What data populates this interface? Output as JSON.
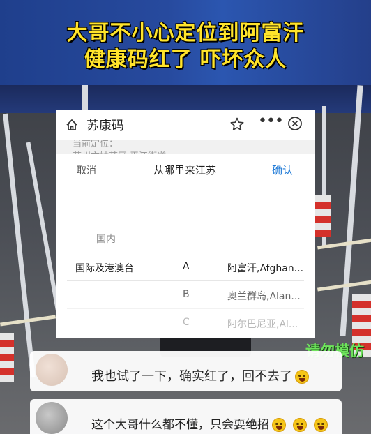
{
  "banner": {
    "line1": "大哥不小心定位到阿富汗",
    "line2": "健康码红了 吓坏众人"
  },
  "watermark": "请勿模仿",
  "app": {
    "title": "苏康码",
    "icons": [
      "home-icon",
      "star-icon",
      "more-icon",
      "close-icon"
    ],
    "more_label": "•••",
    "peek_lines": [
      "当前定位：",
      "苏州市姑苏区 平江街道"
    ]
  },
  "picker": {
    "cancel_label": "取消",
    "title": "从哪里来江苏",
    "confirm_label": "确认",
    "domestic_label": "国内",
    "rows": [
      {
        "region": "国际及港澳台",
        "letter": "A",
        "country": "阿富汗,Afghan..."
      },
      {
        "region": "",
        "letter": "B",
        "country": "奥兰群岛,Alan..."
      },
      {
        "region": "",
        "letter": "C",
        "country": "阿尔巴尼亚,Al..."
      }
    ]
  },
  "comments": [
    {
      "text": "我也试了一下，确实红了，回不去了",
      "emoji_count": 1
    },
    {
      "text": "这个大哥什么都不懂，只会耍绝招",
      "emoji_count": 3
    }
  ],
  "colors": {
    "banner_text": "#ffe42b",
    "banner_bg": "#274a9e",
    "confirm": "#1c78d6",
    "watermark": "#6ee35c"
  }
}
